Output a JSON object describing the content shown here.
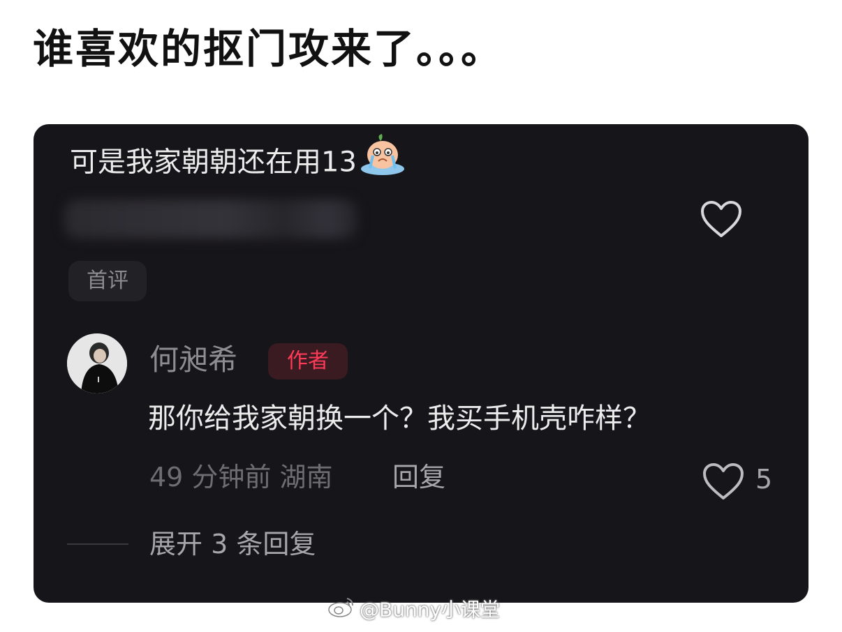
{
  "post": {
    "title": "谁喜欢的抠门攻来了。。。"
  },
  "comment": {
    "text": "可是我家朝朝还在用13",
    "emoji_icon": "crying-emoji-icon",
    "like_icon": "heart-outline-icon",
    "badge": "首评"
  },
  "reply": {
    "author": "何昶希",
    "author_badge": "作者",
    "text": "那你给我家朝换一个？我买手机壳咋样？",
    "time_location": "49 分钟前  湖南",
    "reply_label": "回复",
    "like_count": "5"
  },
  "thread": {
    "expand_label": "展开 3 条回复"
  },
  "watermark": {
    "text": "@Bunny小课堂"
  },
  "colors": {
    "card_bg": "#161519",
    "author_badge_text": "#ff3b58",
    "author_badge_bg": "#3a1b22"
  }
}
